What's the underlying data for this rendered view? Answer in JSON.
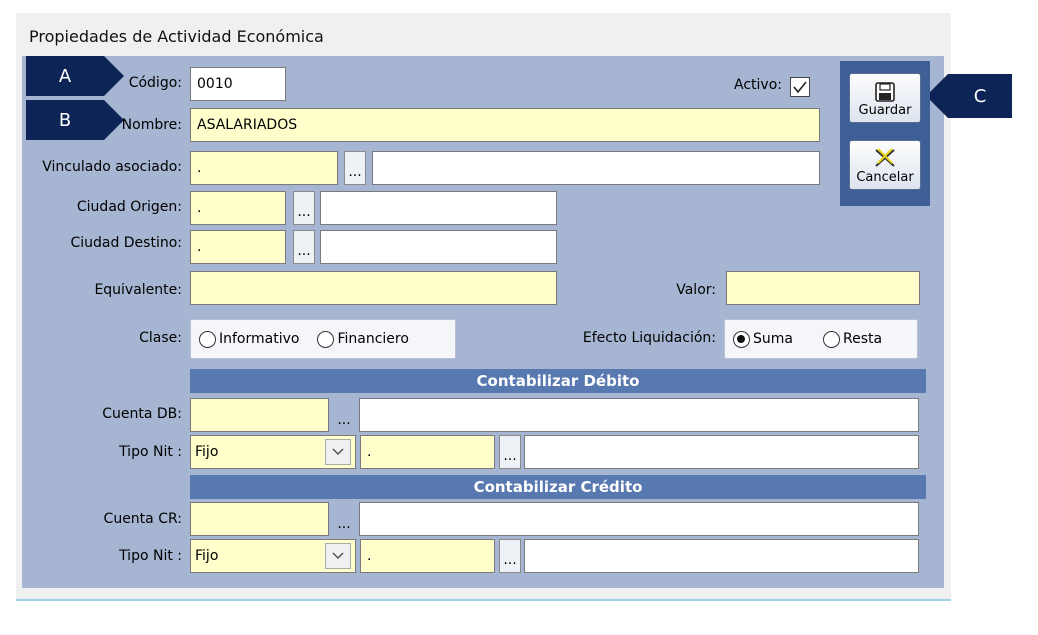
{
  "window": {
    "title": "Propiedades de Actividad Económica"
  },
  "callouts": {
    "a": "A",
    "b": "B",
    "c": "C"
  },
  "form": {
    "codigo": {
      "label": "Código:",
      "value": "0010"
    },
    "activo": {
      "label": "Activo:",
      "checked": true
    },
    "nombre": {
      "label": "Nombre:",
      "value": "ASALARIADOS"
    },
    "vinculado": {
      "label": "Vinculado asociado:",
      "code": ".",
      "browse": "...",
      "desc": ""
    },
    "ciudad_origen": {
      "label": "Ciudad Origen:",
      "code": ".",
      "browse": "...",
      "desc": ""
    },
    "ciudad_destino": {
      "label": "Ciudad Destino:",
      "code": ".",
      "browse": "...",
      "desc": ""
    },
    "equivalente": {
      "label": "Equivalente:",
      "value": ""
    },
    "valor": {
      "label": "Valor:",
      "value": ""
    },
    "clase": {
      "label": "Clase:",
      "options": [
        "Informativo",
        "Financiero"
      ],
      "selected": null
    },
    "efecto": {
      "label": "Efecto Liquidación:",
      "options": [
        "Suma",
        "Resta"
      ],
      "selected": "Suma"
    }
  },
  "debito": {
    "title": "Contabilizar Débito",
    "cuenta": {
      "label": "Cuenta DB:",
      "code": "",
      "browse": "...",
      "desc": ""
    },
    "tipo_nit": {
      "label": "Tipo Nit :",
      "selected": "Fijo",
      "code": ".",
      "browse": "...",
      "desc": ""
    }
  },
  "credito": {
    "title": "Contabilizar Crédito",
    "cuenta": {
      "label": "Cuenta CR:",
      "code": "",
      "browse": "...",
      "desc": ""
    },
    "tipo_nit": {
      "label": "Tipo Nit :",
      "selected": "Fijo",
      "code": ".",
      "browse": "...",
      "desc": ""
    }
  },
  "toolbar": {
    "save_label": "Guardar",
    "save_icon": "floppy-disk-icon",
    "cancel_label": "Cancelar",
    "cancel_icon": "cancel-x-icon"
  },
  "colors": {
    "panel": "#a6b6d2",
    "section_header": "#5878b0",
    "field_required": "#ffffcc",
    "callout": "#0d2456",
    "button_column": "#3f5f97"
  }
}
